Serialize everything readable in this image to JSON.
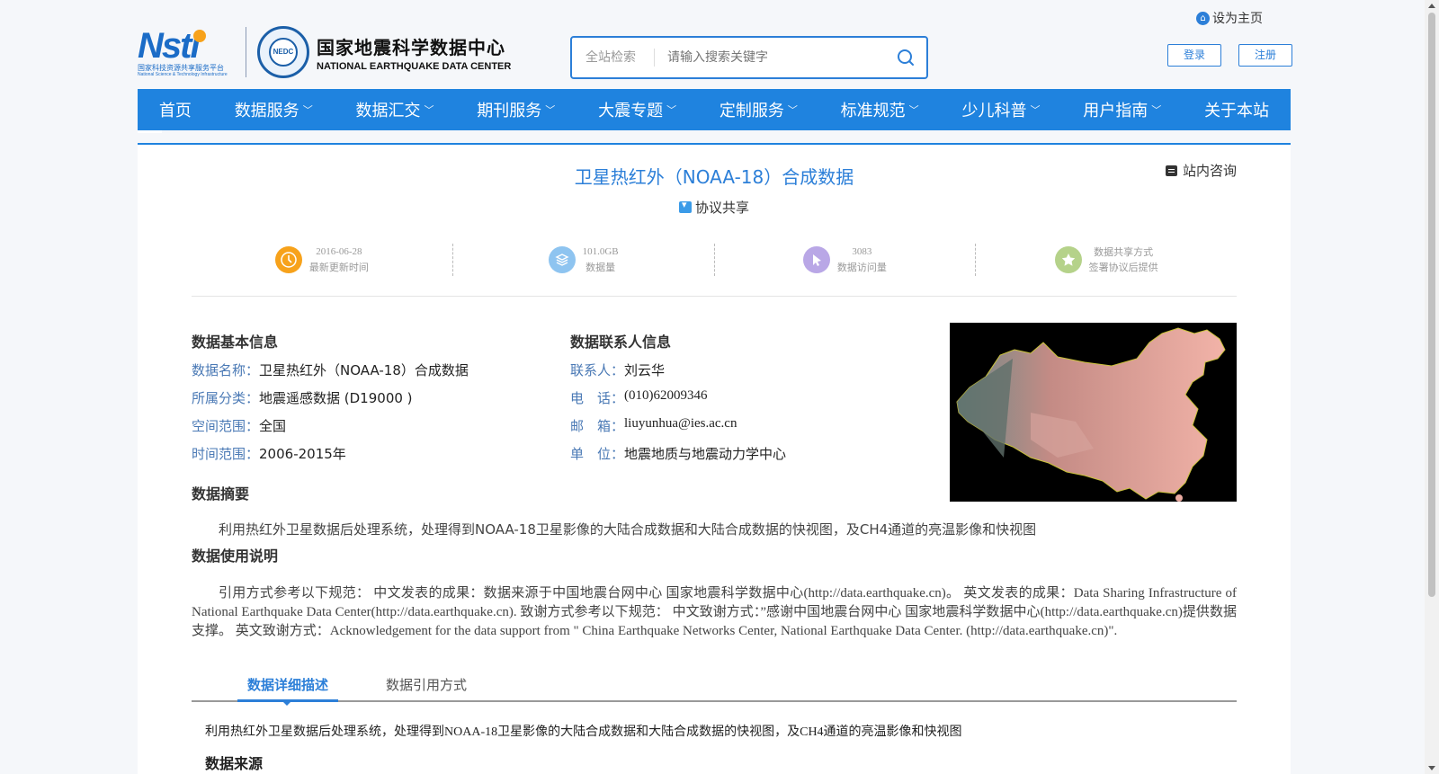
{
  "header": {
    "set_home": "设为主页",
    "nsti": {
      "logo_text": "Nsti",
      "sub_cn": "国家科技资源共享服务平台",
      "sub_en": "National Science & Technology Infrastructure"
    },
    "center": {
      "seal_text": "NEDC",
      "name_cn": "国家地震科学数据中心",
      "name_en": "NATIONAL EARTHQUAKE DATA CENTER"
    },
    "search": {
      "scope": "全站检索",
      "placeholder": "请输入搜索关键字"
    },
    "login": "登录",
    "register": "注册"
  },
  "nav": {
    "items": [
      {
        "label": "首页",
        "dropdown": false
      },
      {
        "label": "数据服务",
        "dropdown": true
      },
      {
        "label": "数据汇交",
        "dropdown": true
      },
      {
        "label": "期刊服务",
        "dropdown": true
      },
      {
        "label": "大震专题",
        "dropdown": true
      },
      {
        "label": "定制服务",
        "dropdown": true
      },
      {
        "label": "标准规范",
        "dropdown": true
      },
      {
        "label": "少儿科普",
        "dropdown": true
      },
      {
        "label": "用户指南",
        "dropdown": true
      },
      {
        "label": "关于本站",
        "dropdown": false
      }
    ],
    "chevron": "﹀"
  },
  "dataset": {
    "title": "卫星热红外（NOAA-18）合成数据",
    "consult": "站内咨询",
    "share": "协议共享",
    "stats": [
      {
        "value": "2016-06-28",
        "label": "最新更新时间",
        "icon": "clock-icon",
        "color": "#f7a21b"
      },
      {
        "value": "101.0GB",
        "label": "数据量",
        "icon": "layers-icon",
        "color": "#8ec4f0"
      },
      {
        "value": "3083",
        "label": "数据访问量",
        "icon": "pointer-icon",
        "color": "#b9a7e6"
      },
      {
        "value": "数据共享方式",
        "label": "签署协议后提供",
        "icon": "star-icon",
        "color": "#b5d28a"
      }
    ],
    "basic_info": {
      "heading": "数据基本信息",
      "name_label": "数据名称：",
      "name_value": "卫星热红外（NOAA-18）合成数据",
      "category_label": "所属分类：",
      "category_value": "地震遥感数据 (D19000 )",
      "space_label": "空间范围：",
      "space_value": "全国",
      "time_label": "时间范围：",
      "time_value": "2006-2015年"
    },
    "contact_info": {
      "heading": "数据联系人信息",
      "person_label": "联系人：",
      "person_value": "刘云华",
      "phone_label": "电　话：",
      "phone_value": "(010)62009346",
      "email_label": "邮　箱：",
      "email_value": "liuyunhua@ies.ac.cn",
      "unit_label": "单　位：",
      "unit_value": "地震地质与地震动力学中心"
    },
    "abstract_heading": "数据摘要",
    "abstract": "利用热红外卫星数据后处理系统，处理得到NOAA-18卫星影像的大陆合成数据和大陆合成数据的快视图，及CH4通道的亮温影像和快视图",
    "usage_heading": "数据使用说明",
    "usage": "引用方式参考以下规范： 中文发表的成果：数据来源于中国地震台网中心 国家地震科学数据中心(http://data.earthquake.cn)。 英文发表的成果：Data Sharing Infrastructure of National Earthquake Data Center(http://data.earthquake.cn). 致谢方式参考以下规范： 中文致谢方式：”感谢中国地震台网中心 国家地震科学数据中心(http://data.earthquake.cn)提供数据支撑。 英文致谢方式：Acknowledgement for the data support from \" China Earthquake Networks Center, National Earthquake Data Center. (http://data.earthquake.cn)\".",
    "tabs": [
      "数据详细描述",
      "数据引用方式"
    ],
    "detail_text": "利用热红外卫星数据后处理系统，处理得到NOAA-18卫星影像的大陆合成数据和大陆合成数据的快视图，及CH4通道的亮温影像和快视图",
    "source_heading": "数据来源"
  },
  "colors": {
    "brand_blue": "#1f83df",
    "link_blue": "#2c7fd8"
  }
}
